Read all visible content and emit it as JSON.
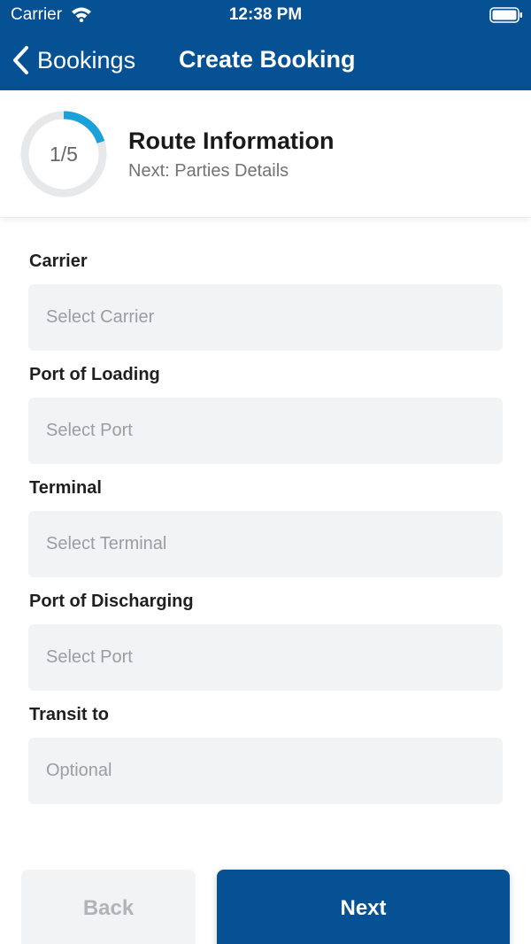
{
  "status_bar": {
    "carrier": "Carrier",
    "time": "12:38 PM",
    "icons": [
      "wifi-icon",
      "battery-icon"
    ]
  },
  "nav": {
    "back_label": "Bookings",
    "title": "Create Booking",
    "back_icon": "chevron-left-icon"
  },
  "step": {
    "progress_text": "1/5",
    "progress_fraction": 0.2,
    "title": "Route Information",
    "next": "Next: Parties Details"
  },
  "fields": [
    {
      "label": "Carrier",
      "placeholder": "Select Carrier"
    },
    {
      "label": "Port of Loading",
      "placeholder": "Select Port"
    },
    {
      "label": "Terminal",
      "placeholder": "Select Terminal"
    },
    {
      "label": "Port of Discharging",
      "placeholder": "Select Port"
    },
    {
      "label": "Transit to",
      "placeholder": "Optional"
    }
  ],
  "buttons": {
    "back": "Back",
    "next": "Next"
  },
  "colors": {
    "brand": "#065194",
    "progress_accent": "#1aa1d9",
    "progress_track": "#e6e8ea",
    "field_bg": "#f1f3f5"
  }
}
